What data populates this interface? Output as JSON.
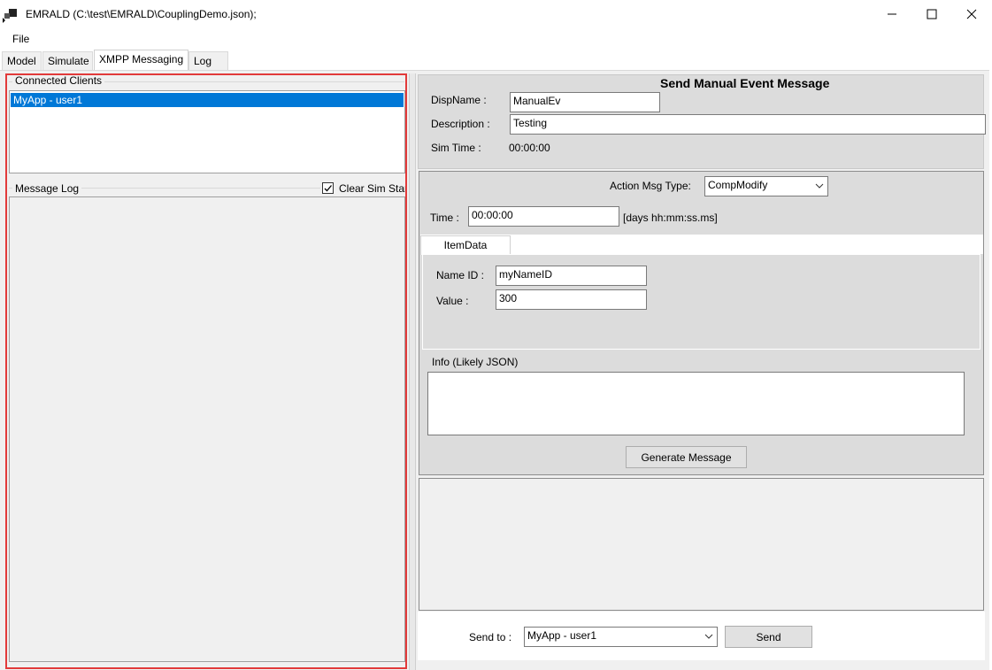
{
  "window": {
    "title": "EMRALD (C:\\test\\EMRALD\\CouplingDemo.json);",
    "icon": "app-icon"
  },
  "menu": {
    "file": "File"
  },
  "tabs": [
    "Model",
    "Simulate",
    "XMPP Messaging",
    "Log"
  ],
  "active_tab": "XMPP Messaging",
  "left": {
    "clients_label": "Connected Clients",
    "clients": [
      "MyApp - user1"
    ],
    "msglog_label": "Message Log",
    "clear_label": "Clear Sim Start",
    "clear_checked": true
  },
  "right": {
    "header": "Send Manual Event Message",
    "dispname_label": "DispName :",
    "dispname_value": "ManualEv",
    "description_label": "Description :",
    "description_value": "Testing",
    "simtime_label": "Sim Time :",
    "simtime_value": "00:00:00",
    "action_label": "Action Msg Type:",
    "action_value": "CompModify",
    "time_label": "Time :",
    "time_value": "00:00:00",
    "time_hint": "[days hh:mm:ss.ms]",
    "itemdata_tab": "ItemData",
    "nameid_label": "Name ID :",
    "nameid_value": "myNameID",
    "value_label": "Value :",
    "value_value": "300",
    "info_label": "Info (Likely JSON)",
    "info_value": "",
    "generate_label": "Generate Message",
    "sendto_label": "Send to :",
    "sendto_value": "MyApp - user1",
    "send_label": "Send"
  },
  "colors": {
    "selection": "#0078d7",
    "highlight_border": "#e23a3a",
    "panel": "#dcdcdc"
  }
}
